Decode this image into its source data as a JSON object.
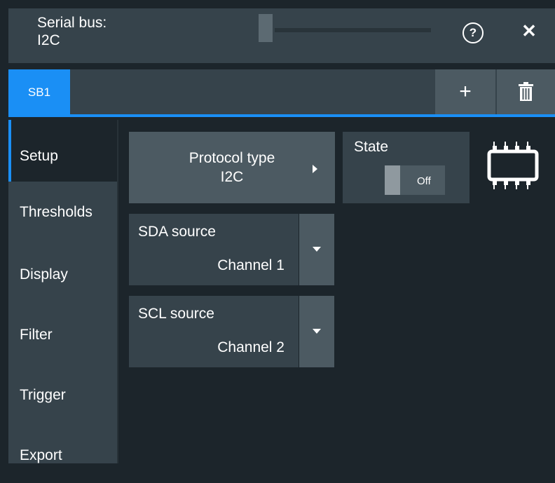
{
  "header": {
    "title": "Serial bus:\nI2C",
    "help_icon": "question-circle-icon",
    "close_label": "✕"
  },
  "tabs": {
    "items": [
      {
        "label": "SB1",
        "active": true
      }
    ],
    "add_label": "+",
    "delete_icon": "trash-icon"
  },
  "nav": {
    "items": [
      {
        "label": "Setup",
        "active": true
      },
      {
        "label": "Thresholds"
      },
      {
        "label": "Display"
      },
      {
        "label": "Filter"
      },
      {
        "label": "Trigger"
      },
      {
        "label": "Export"
      }
    ]
  },
  "setup": {
    "protocol_button": "Protocol type\nI2C",
    "state": {
      "label": "State",
      "value": "Off"
    },
    "sda_source": {
      "label": "SDA source",
      "value": "Channel 1"
    },
    "scl_source": {
      "label": "SCL source",
      "value": "Channel 2"
    },
    "chip_icon": "ic-chip-icon"
  },
  "colors": {
    "accent": "#1a8ff5",
    "background": "#1c252b",
    "panel": "#36434b",
    "button": "#4c5a62"
  }
}
